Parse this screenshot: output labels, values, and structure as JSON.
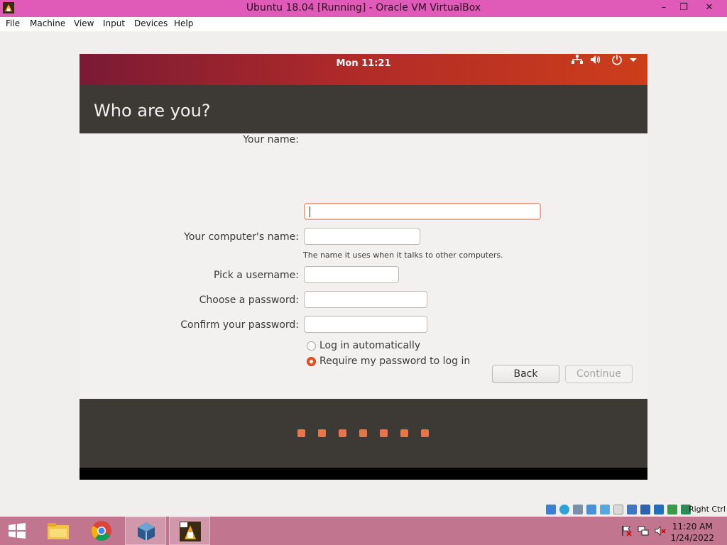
{
  "window": {
    "title": "Ubuntu 18.04 [Running] - Oracle VM VirtualBox",
    "controls": [
      "minimize-icon",
      "restore-icon",
      "close-icon"
    ]
  },
  "menubar": {
    "items": [
      "File",
      "Machine",
      "View",
      "Input",
      "Devices",
      "Help"
    ]
  },
  "topbar": {
    "clock": "Mon 11:21",
    "icons": [
      "network-icon",
      "volume-icon",
      "power-icon",
      "dropdown-arrow-icon"
    ]
  },
  "installer": {
    "title": "Who are you?",
    "fields": {
      "your_name": {
        "label": "Your name:",
        "value": ""
      },
      "computer_name": {
        "label": "Your computer's name:",
        "value": "",
        "hint": "The name it uses when it talks to other computers."
      },
      "username": {
        "label": "Pick a username:",
        "value": ""
      },
      "password": {
        "label": "Choose a password:",
        "value": ""
      },
      "confirm_password": {
        "label": "Confirm your password:",
        "value": ""
      }
    },
    "login_options": [
      {
        "label": "Log in automatically",
        "checked": false
      },
      {
        "label": "Require my password to log in",
        "checked": true
      }
    ],
    "buttons": {
      "back": "Back",
      "continue": "Continue"
    },
    "progress": {
      "dots": 7
    }
  },
  "statusbar": {
    "host_key": "Right Ctrl"
  },
  "taskbar": {
    "apps": [
      "windows-start-icon",
      "file-explorer-icon",
      "chrome-icon",
      "virtualbox-manager-icon",
      "virtualbox-vm-icon"
    ],
    "time": "11:20 AM",
    "date": "1/24/2022"
  },
  "colors": {
    "ubuntu_orange": "#e95420",
    "aubergine_dark": "#3d3a36",
    "titlebar": "#e05bb7",
    "taskbar": "#c2758f"
  }
}
